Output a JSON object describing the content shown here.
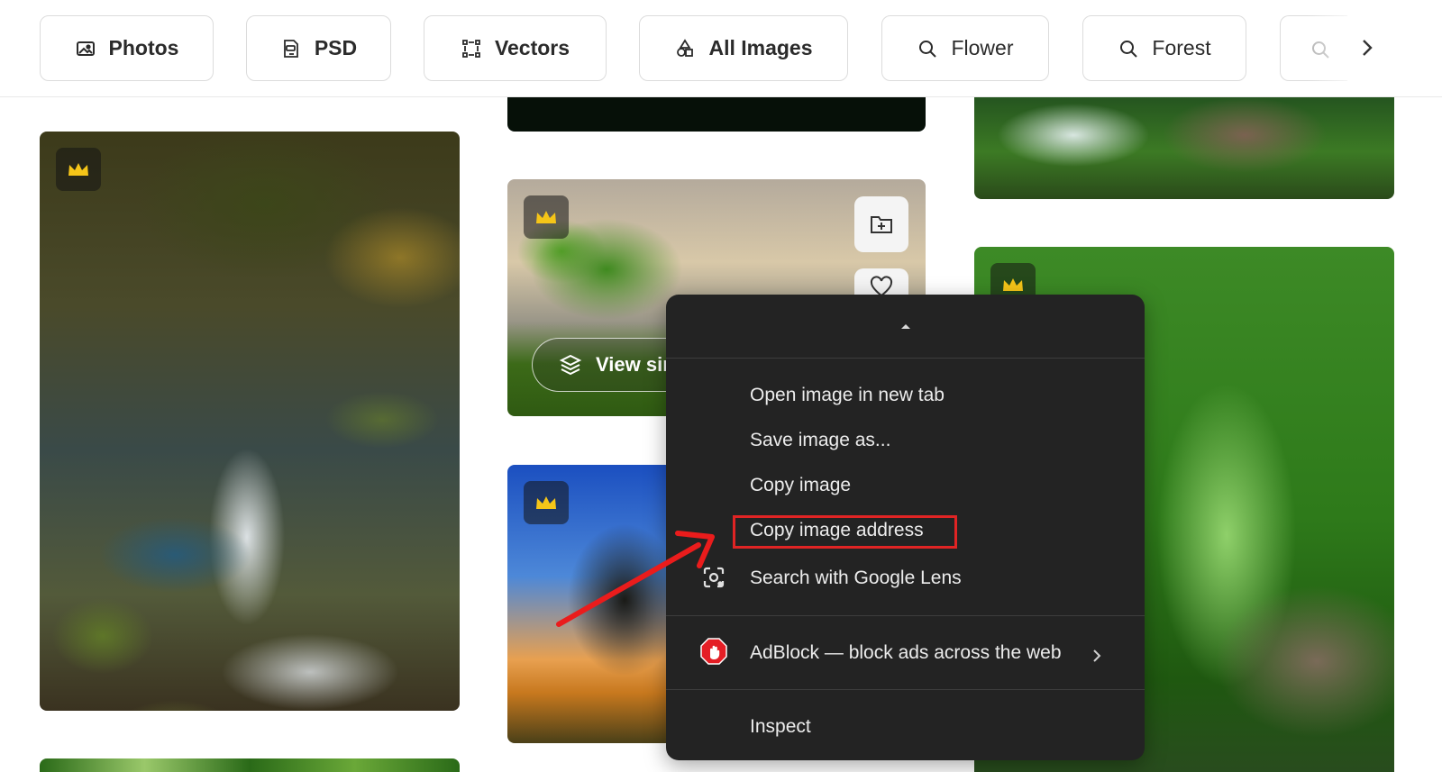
{
  "filters": [
    {
      "label": "Photos",
      "icon": "photo-icon",
      "bold": true
    },
    {
      "label": "PSD",
      "icon": "psd-file-icon",
      "bold": true
    },
    {
      "label": "Vectors",
      "icon": "vector-icon",
      "bold": true
    },
    {
      "label": "All Images",
      "icon": "shapes-icon",
      "bold": true
    },
    {
      "label": "Flower",
      "icon": "search-icon",
      "bold": false
    },
    {
      "label": "Forest",
      "icon": "search-icon",
      "bold": false
    }
  ],
  "grid": {
    "view_similar_label": "View sir"
  },
  "context_menu": {
    "items": [
      {
        "label": "Open image in new tab"
      },
      {
        "label": "Save image as..."
      },
      {
        "label": "Copy image"
      },
      {
        "label": "Copy image address",
        "highlighted": true
      },
      {
        "label": "Search with Google Lens",
        "icon": "google-lens-icon"
      }
    ],
    "extension_item": {
      "label": "AdBlock — block ads across the web",
      "icon": "adblock-icon",
      "has_submenu": true
    },
    "inspect_label": "Inspect"
  },
  "colors": {
    "accent_premium": "#f5c518",
    "annotation_red": "#e02424",
    "menu_bg": "#232323"
  }
}
